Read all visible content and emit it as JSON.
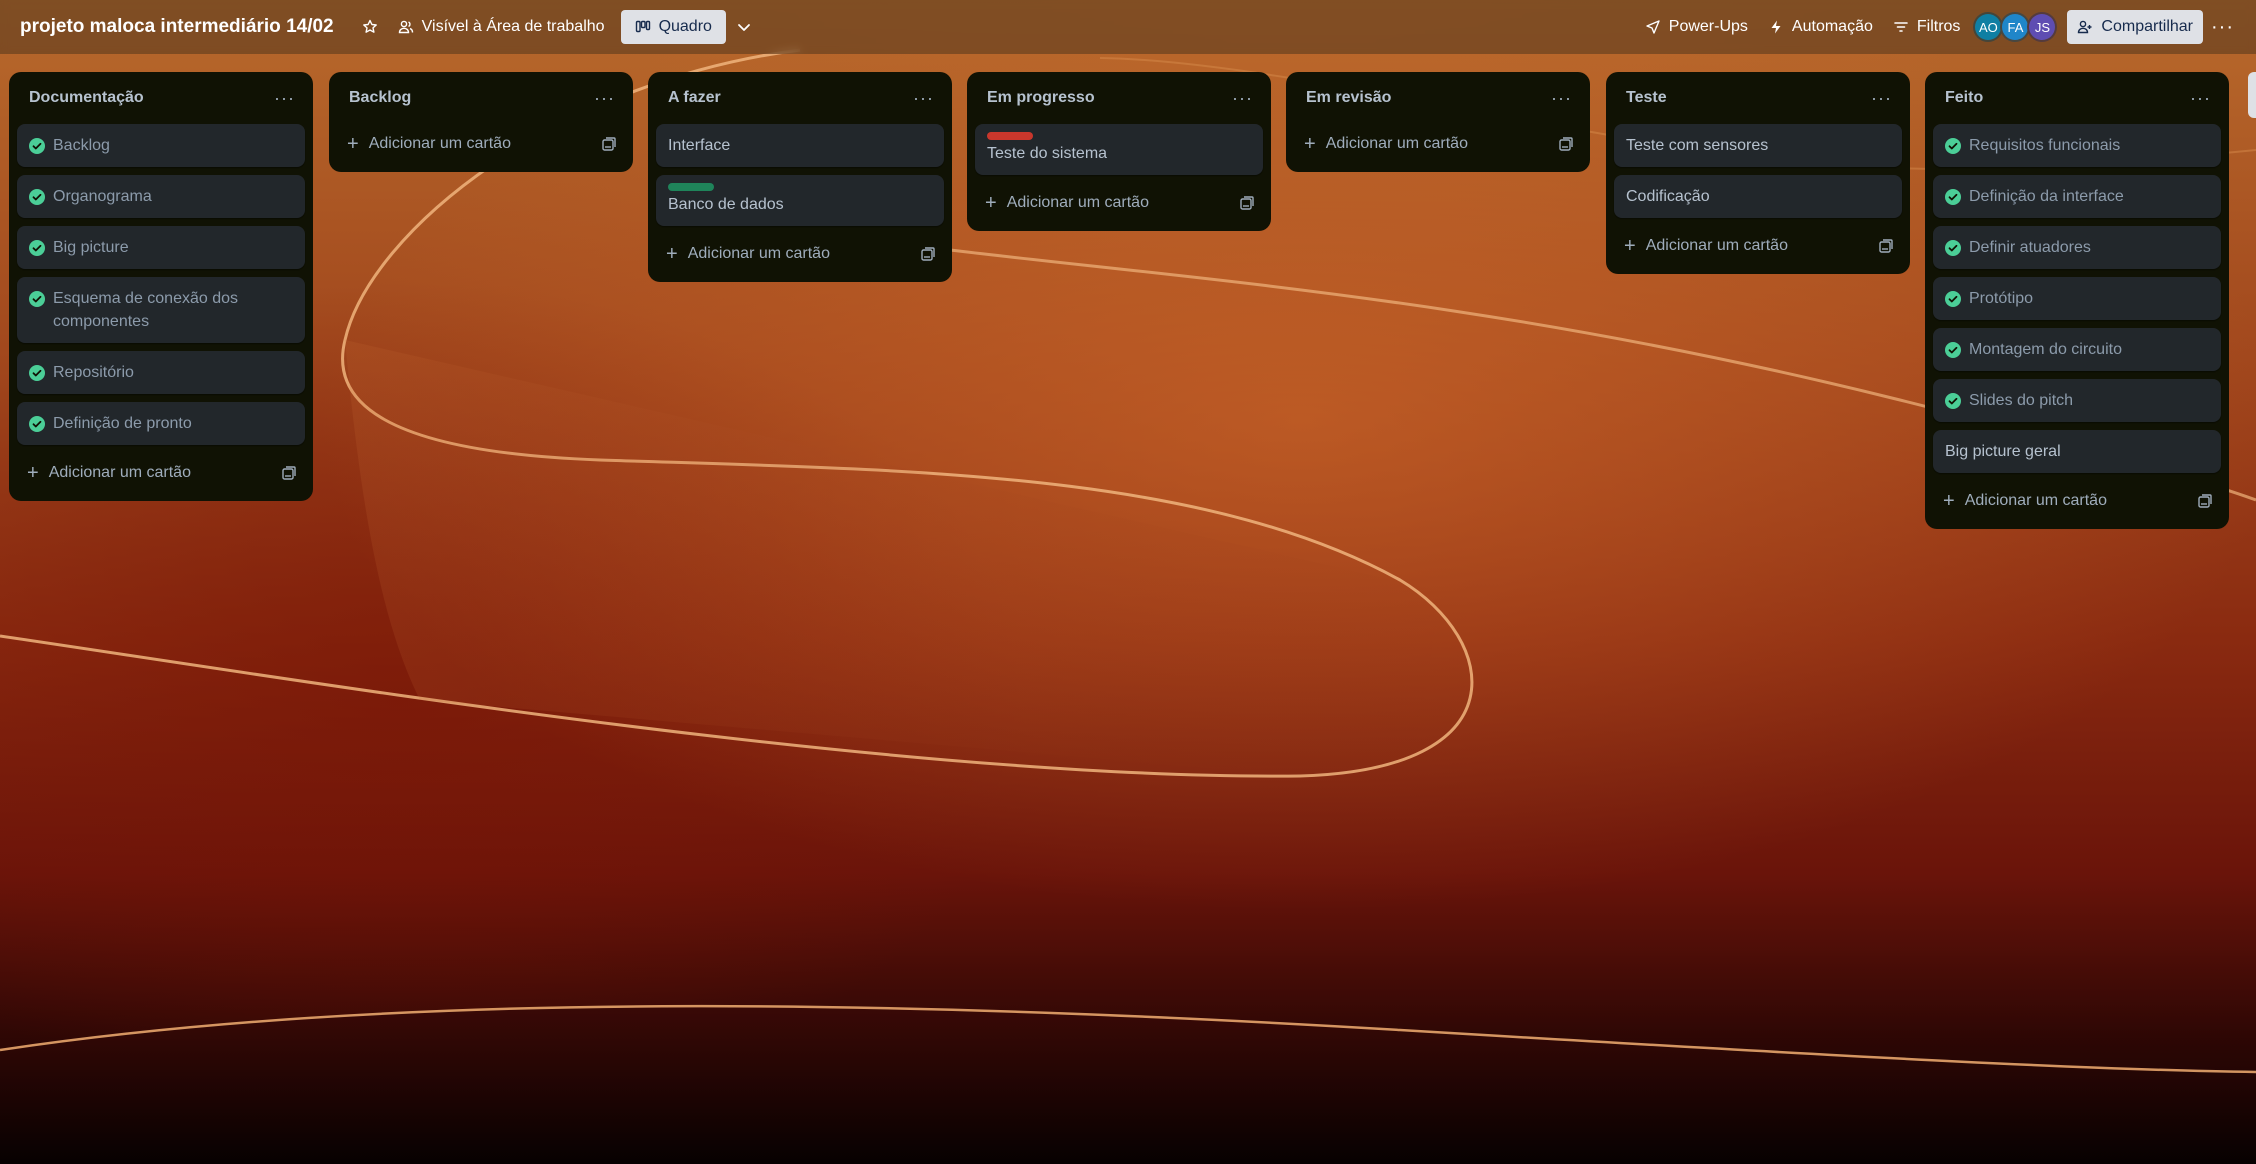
{
  "header": {
    "board_title": "projeto maloca intermediário 14/02",
    "visibility_label": "Visível à Área de trabalho",
    "view_label": "Quadro",
    "powerups_label": "Power-Ups",
    "automation_label": "Automação",
    "filters_label": "Filtros",
    "share_label": "Compartilhar",
    "more_label": "···",
    "members": [
      {
        "initials": "AO",
        "color": "#0f7fa3"
      },
      {
        "initials": "FA",
        "color": "#1f86c9"
      },
      {
        "initials": "JS",
        "color": "#5e4db2"
      }
    ]
  },
  "add_card_label": "Adicionar um cartão",
  "list_menu_label": "···",
  "colors": {
    "done_green": "#4bce97",
    "label_red": "#c9372c",
    "label_green": "#1f845a"
  },
  "lists": [
    {
      "title": "Documentação",
      "cards": [
        {
          "title": "Backlog",
          "done": true
        },
        {
          "title": "Organograma",
          "done": true
        },
        {
          "title": "Big picture",
          "done": true
        },
        {
          "title": "Esquema de conexão dos componentes",
          "done": true
        },
        {
          "title": "Repositório",
          "done": true
        },
        {
          "title": "Definição de pronto",
          "done": true
        }
      ]
    },
    {
      "title": "Backlog",
      "cards": []
    },
    {
      "title": "A fazer",
      "cards": [
        {
          "title": "Interface",
          "done": false
        },
        {
          "title": "Banco de dados",
          "done": false,
          "label": "label_green"
        }
      ]
    },
    {
      "title": "Em progresso",
      "cards": [
        {
          "title": "Teste do sistema",
          "done": false,
          "label": "label_red"
        }
      ]
    },
    {
      "title": "Em revisão",
      "cards": []
    },
    {
      "title": "Teste",
      "cards": [
        {
          "title": "Teste com sensores",
          "done": false
        },
        {
          "title": "Codificação",
          "done": false
        }
      ]
    },
    {
      "title": "Feito",
      "cards": [
        {
          "title": "Requisitos funcionais",
          "done": true
        },
        {
          "title": "Definição da interface",
          "done": true
        },
        {
          "title": "Definir atuadores",
          "done": true
        },
        {
          "title": "Protótipo",
          "done": true
        },
        {
          "title": "Montagem do circuito",
          "done": true
        },
        {
          "title": "Slides do pitch",
          "done": true
        },
        {
          "title": "Big picture geral",
          "done": false
        }
      ]
    }
  ]
}
